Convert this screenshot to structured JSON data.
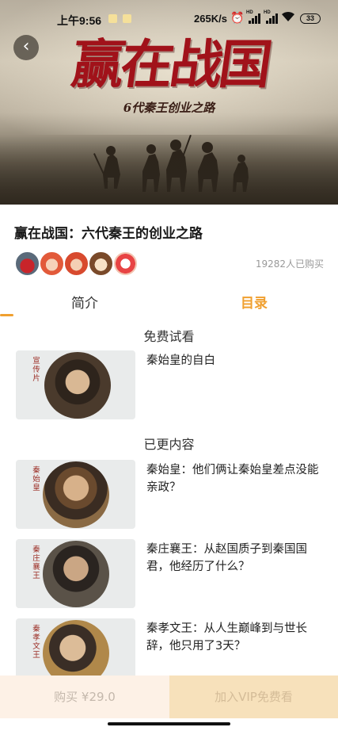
{
  "status_bar": {
    "time": "上午9:56",
    "net_speed": "265K/s",
    "alarm_icon": "⏰",
    "signal_label_1": "HD",
    "signal_label_2": "HD",
    "wifi_icon": "wifi",
    "battery": "33"
  },
  "banner": {
    "art_title": "赢在战国",
    "art_subtitle": "6代秦王创业之路",
    "back_icon": "‹"
  },
  "course": {
    "title": "赢在战国：六代秦王的创业之路",
    "buy_count": "19282人已购买"
  },
  "tabs": {
    "intro": "简介",
    "catalog": "目录"
  },
  "sections": {
    "free": "免费试看",
    "updated": "已更内容"
  },
  "episodes": [
    {
      "tag": "宣传片",
      "title": "秦始皇的自白"
    },
    {
      "tag": "秦始皇",
      "title": "秦始皇：他们俩让秦始皇差点没能亲政？"
    },
    {
      "tag": "秦庄襄王",
      "title": "秦庄襄王：从赵国质子到秦国国君，他经历了什么？"
    },
    {
      "tag": "秦孝文王",
      "title": "秦孝文王：从人生巅峰到与世长辞，他只用了3天？"
    }
  ],
  "bottom_bar": {
    "buy_label": "购买 ¥29.0",
    "vip_label": "加入VIP免费看"
  },
  "colors": {
    "accent": "#f0a030",
    "banner_title": "#a1121a"
  }
}
